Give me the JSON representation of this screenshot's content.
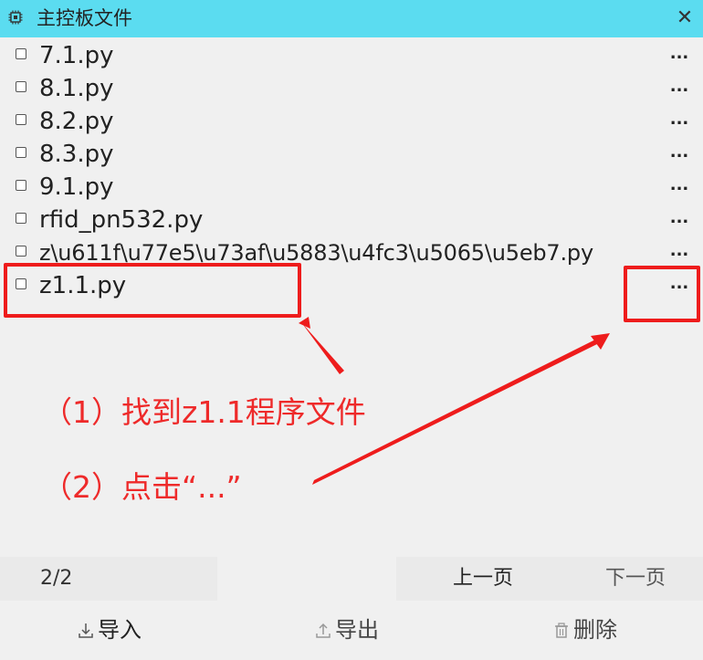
{
  "window": {
    "title": "主控板文件",
    "title_icon": "chip-icon",
    "close_symbol": "✕",
    "accent_color": "#5bdcf0"
  },
  "files": [
    {
      "name": "7.1.py",
      "more": "..."
    },
    {
      "name": "8.1.py",
      "more": "..."
    },
    {
      "name": "8.2.py",
      "more": "..."
    },
    {
      "name": "8.3.py",
      "more": "..."
    },
    {
      "name": "9.1.py",
      "more": "..."
    },
    {
      "name": "rfid_pn532.py",
      "more": "..."
    },
    {
      "name": "z\\u611f\\u77e5\\u73af\\u5883\\u4fc3\\u5065\\u5eb7.py",
      "more": "..."
    },
    {
      "name": "z1.1.py",
      "more": "..."
    }
  ],
  "annotations": {
    "step1": "（1）找到z1.1程序文件",
    "step2": "（2）点击“...”",
    "color": "#ee1c1c"
  },
  "pager": {
    "page_count": "2/2",
    "prev_label": "上一页",
    "next_label": "下一页"
  },
  "actions": {
    "import_label": "导入",
    "export_label": "导出",
    "delete_label": "删除",
    "import_icon": "download-icon",
    "export_icon": "upload-icon",
    "delete_icon": "trash-icon"
  }
}
